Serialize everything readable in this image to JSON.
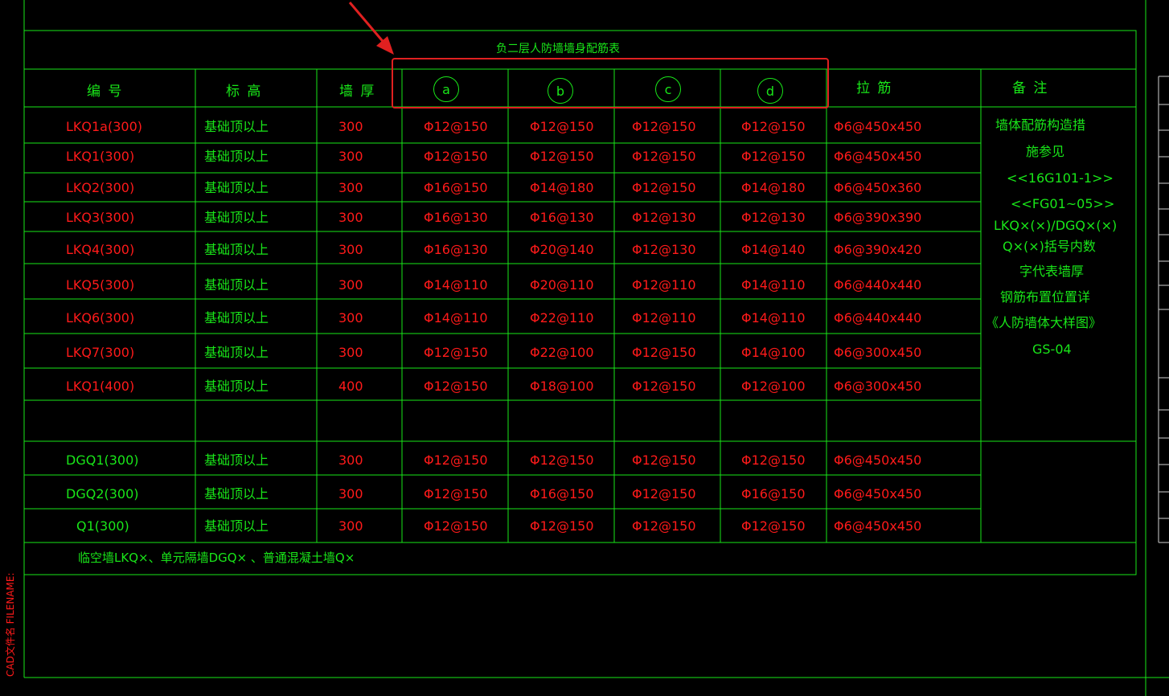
{
  "title": "负二层人防墙墙身配筋表",
  "headers": [
    "编 号",
    "标 高",
    "墙 厚",
    "a",
    "b",
    "c",
    "d",
    "拉 筋",
    "备 注"
  ],
  "rows": [
    {
      "id": "LKQ1a(300)",
      "elev": "基础顶以上",
      "thk": "300",
      "a": "Φ12@150",
      "b": "Φ12@150",
      "c": "Φ12@150",
      "d": "Φ12@150",
      "tie": "Φ6@450x450"
    },
    {
      "id": "LKQ1(300)",
      "elev": "基础顶以上",
      "thk": "300",
      "a": "Φ12@150",
      "b": "Φ12@150",
      "c": "Φ12@150",
      "d": "Φ12@150",
      "tie": "Φ6@450x450"
    },
    {
      "id": "LKQ2(300)",
      "elev": "基础顶以上",
      "thk": "300",
      "a": "Φ16@150",
      "b": "Φ14@180",
      "c": "Φ12@150",
      "d": "Φ14@180",
      "tie": "Φ6@450x360"
    },
    {
      "id": "LKQ3(300)",
      "elev": "基础顶以上",
      "thk": "300",
      "a": "Φ16@130",
      "b": "Φ16@130",
      "c": "Φ12@130",
      "d": "Φ12@130",
      "tie": "Φ6@390x390"
    },
    {
      "id": "LKQ4(300)",
      "elev": "基础顶以上",
      "thk": "300",
      "a": "Φ16@130",
      "b": "Φ20@140",
      "c": "Φ12@130",
      "d": "Φ14@140",
      "tie": "Φ6@390x420"
    },
    {
      "id": "LKQ5(300)",
      "elev": "基础顶以上",
      "thk": "300",
      "a": "Φ14@110",
      "b": "Φ20@110",
      "c": "Φ12@110",
      "d": "Φ14@110",
      "tie": "Φ6@440x440"
    },
    {
      "id": "LKQ6(300)",
      "elev": "基础顶以上",
      "thk": "300",
      "a": "Φ14@110",
      "b": "Φ22@110",
      "c": "Φ12@110",
      "d": "Φ14@110",
      "tie": "Φ6@440x440"
    },
    {
      "id": "LKQ7(300)",
      "elev": "基础顶以上",
      "thk": "300",
      "a": "Φ12@150",
      "b": "Φ22@100",
      "c": "Φ12@150",
      "d": "Φ14@100",
      "tie": "Φ6@300x450"
    },
    {
      "id": "LKQ1(400)",
      "elev": "基础顶以上",
      "thk": "400",
      "a": "Φ12@150",
      "b": "Φ18@100",
      "c": "Φ12@150",
      "d": "Φ12@100",
      "tie": "Φ6@300x450"
    },
    {
      "id": "",
      "elev": "",
      "thk": "",
      "a": "",
      "b": "",
      "c": "",
      "d": "",
      "tie": ""
    },
    {
      "id": "DGQ1(300)",
      "elev": "基础顶以上",
      "thk": "300",
      "a": "Φ12@150",
      "b": "Φ12@150",
      "c": "Φ12@150",
      "d": "Φ12@150",
      "tie": "Φ6@450x450"
    },
    {
      "id": "DGQ2(300)",
      "elev": "基础顶以上",
      "thk": "300",
      "a": "Φ12@150",
      "b": "Φ16@150",
      "c": "Φ12@150",
      "d": "Φ16@150",
      "tie": "Φ6@450x450"
    },
    {
      "id": "Q1(300)",
      "elev": "基础顶以上",
      "thk": "300",
      "a": "Φ12@150",
      "b": "Φ12@150",
      "c": "Φ12@150",
      "d": "Φ12@150",
      "tie": "Φ6@450x450"
    }
  ],
  "remarks": [
    "墙体配筋构造措",
    "施参见",
    "<<16G101-1>>",
    "<<FG01~05>>",
    "LKQ×(×)/DGQ×(×)",
    "Q×(×)括号内数",
    "字代表墙厚",
    "钢筋布置位置详",
    "《人防墙体大样图》",
    "GS-04"
  ],
  "footer_note": "临空墙LKQ×、单元隔墙DGQ× 、普通混凝土墙Q×",
  "side_label": "CAD文件名 FILENAME:",
  "colors": {
    "line": "#19e619",
    "red": "#ff1a1a",
    "highlight": "#e02020",
    "background": "#000000"
  }
}
